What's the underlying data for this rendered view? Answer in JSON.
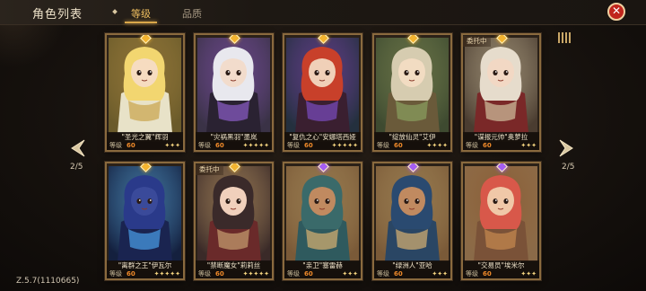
{
  "header": {
    "title": "角色列表",
    "tabs": [
      {
        "label": "等级",
        "active": true
      },
      {
        "label": "品质",
        "active": false
      }
    ],
    "close_icon": "close-icon"
  },
  "pagination": {
    "left": "2/5",
    "right": "2/5"
  },
  "version": "Z.5.7(1110665)",
  "colors": {
    "accent": "#d9a74a",
    "level_value": "#f08a2a",
    "gem_gold": "#f3b431",
    "gem_purple": "#a55ef2",
    "close": "#c0251c"
  },
  "level_label": "等级",
  "cards": [
    {
      "name": "\"圣光之翼\"辉羽",
      "level": "60",
      "stars": "✦✦✦",
      "gem": "gold",
      "tag": ""
    },
    {
      "name": "\"灾祸黑羽\"墨岚",
      "level": "60",
      "stars": "✦✦✦✦✦",
      "gem": "gold",
      "tag": ""
    },
    {
      "name": "\"复仇之心\"安娜塔西娅",
      "level": "60",
      "stars": "✦✦✦✦✦",
      "gem": "gold",
      "tag": ""
    },
    {
      "name": "\"绽放仙灵\"艾伊",
      "level": "60",
      "stars": "✦✦✦✦",
      "gem": "gold",
      "tag": ""
    },
    {
      "name": "\"谍报元帅\"奥萝拉",
      "level": "60",
      "stars": "✦✦✦",
      "gem": "gold",
      "tag": "委托中"
    },
    {
      "name": "\"离群之王\"伊瓦尔",
      "level": "60",
      "stars": "✦✦✦✦✦",
      "gem": "gold",
      "tag": ""
    },
    {
      "name": "\"禁断魔女\"莉莉丝",
      "level": "60",
      "stars": "✦✦✦✦✦",
      "gem": "gold",
      "tag": "委托中"
    },
    {
      "name": "\"亲卫\"塞雷赫",
      "level": "60",
      "stars": "✦✦✦",
      "gem": "purple",
      "tag": ""
    },
    {
      "name": "\"绿洲人\"亚哈",
      "level": "60",
      "stars": "✦✦✦",
      "gem": "purple",
      "tag": ""
    },
    {
      "name": "\"交易员\"埃米尔",
      "level": "60",
      "stars": "✦✦✦",
      "gem": "purple",
      "tag": ""
    }
  ]
}
